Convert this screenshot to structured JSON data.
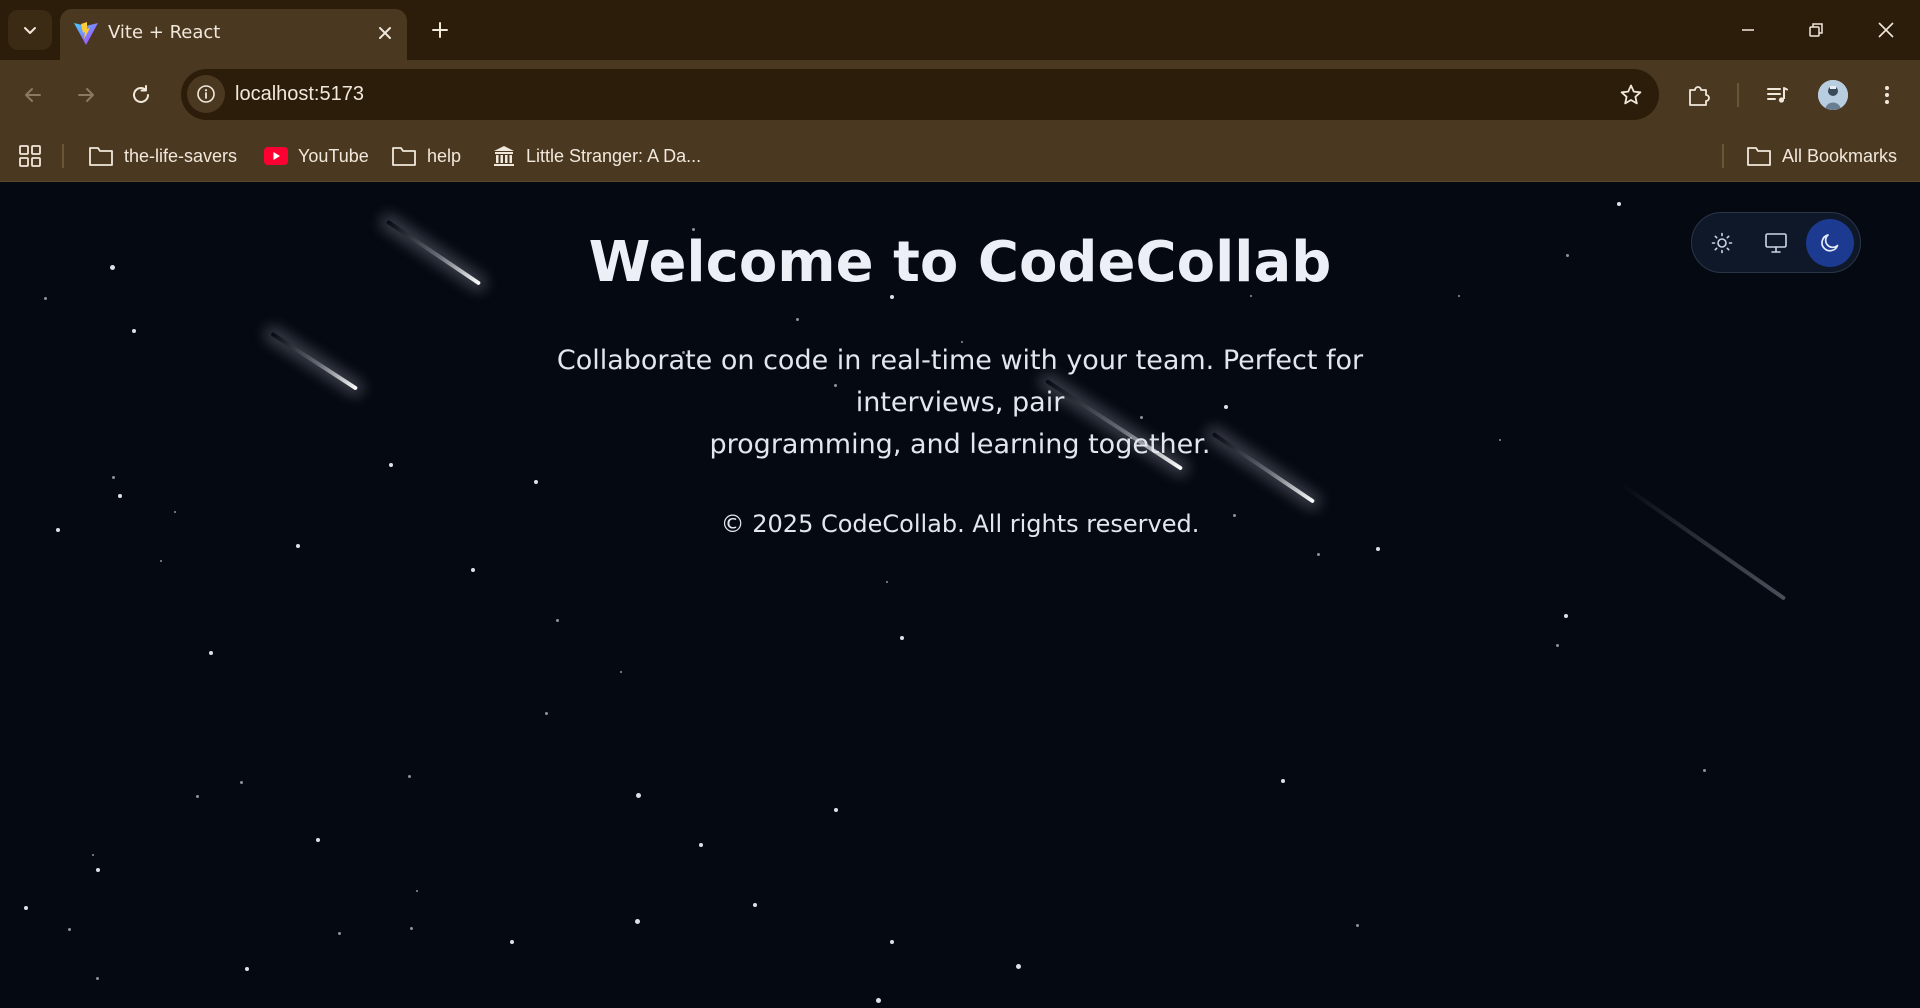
{
  "browser": {
    "tab": {
      "title": "Vite + React"
    },
    "address": {
      "url": "localhost:5173"
    },
    "bookmarks": [
      {
        "label": "the-life-savers",
        "icon": "folder-icon"
      },
      {
        "label": "YouTube",
        "icon": "youtube-icon"
      },
      {
        "label": "help",
        "icon": "folder-icon"
      },
      {
        "label": "Little Stranger: A Da...",
        "icon": "museum-icon"
      }
    ],
    "all_bookmarks_label": "All Bookmarks"
  },
  "page": {
    "title": "Welcome to CodeCollab",
    "tagline_line1": "Collaborate on code in real-time with your team. Perfect for interviews, pair",
    "tagline_line2": "programming, and learning together.",
    "footer": "© 2025 CodeCollab. All rights reserved.",
    "theme_options": [
      "light",
      "system",
      "dark"
    ],
    "theme_selected": "dark"
  },
  "colors": {
    "chrome_dark": "#2c1c0a",
    "chrome": "#4a3820",
    "page_background": "#050912",
    "toggle_active": "#1c3a8f",
    "text": "#eceff6"
  }
}
